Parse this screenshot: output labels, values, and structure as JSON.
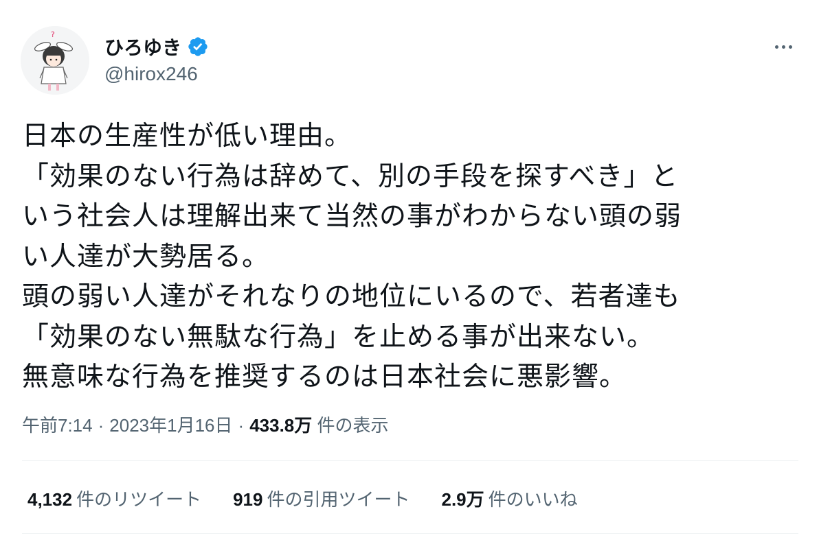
{
  "user": {
    "display_name": "ひろゆき",
    "handle": "@hirox246",
    "verified_color": "#1d9bf0"
  },
  "tweet": {
    "lines": [
      "日本の生産性が低い理由。",
      "「効果のない行為は辞めて、別の手段を探すべき」と",
      "いう社会人は理解出来て当然の事がわからない頭の弱",
      "い人達が大勢居る。",
      "頭の弱い人達がそれなりの地位にいるので、若者達も",
      "「効果のない無駄な行為」を止める事が出来ない。",
      "無意味な行為を推奨するのは日本社会に悪影響。"
    ]
  },
  "meta": {
    "time": "午前7:14",
    "separator": "·",
    "date": "2023年1月16日",
    "views_count": "433.8万",
    "views_label": "件の表示"
  },
  "stats": {
    "retweets_count": "4,132",
    "retweets_label": "件のリツイート",
    "quotes_count": "919",
    "quotes_label": "件の引用ツイート",
    "likes_count": "2.9万",
    "likes_label": "件のいいね"
  },
  "icons": {
    "more": "more-horizontal-icon",
    "verified": "verified-badge-icon"
  }
}
